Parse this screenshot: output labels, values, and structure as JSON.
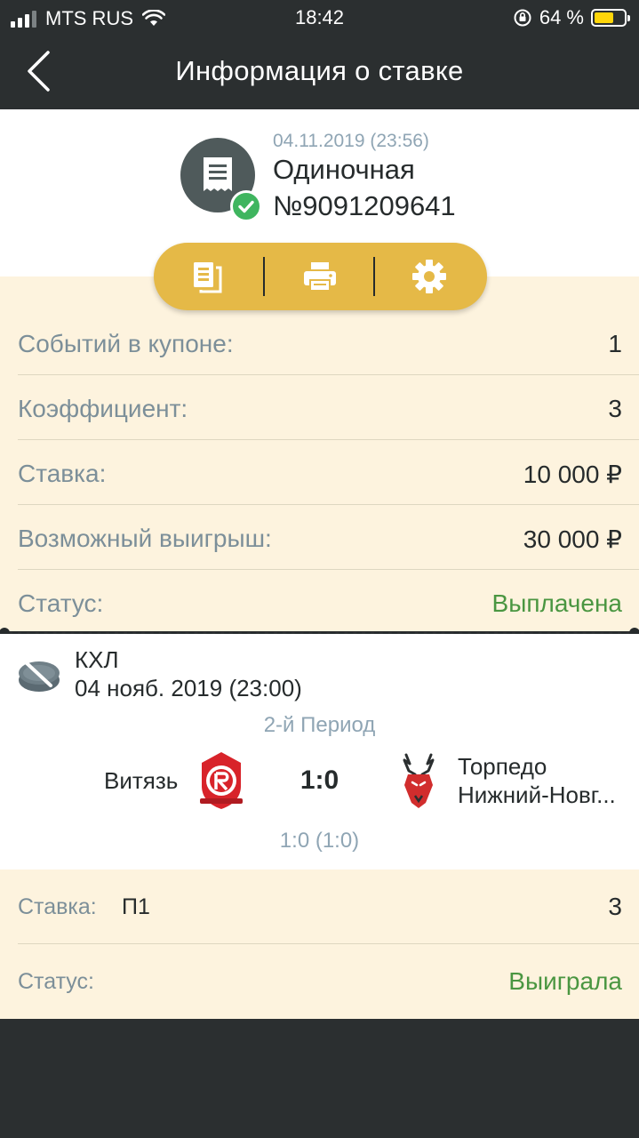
{
  "status_bar": {
    "carrier": "MTS RUS",
    "time": "18:42",
    "battery": "64 %",
    "battery_level": 0.64
  },
  "nav": {
    "title": "Информация о ставке",
    "back_icon": "chevron-left-icon"
  },
  "bet": {
    "date": "04.11.2019 (23:56)",
    "type": "Одиночная",
    "number": "№9091209641",
    "icon": "receipt-icon",
    "badge_icon": "check-icon"
  },
  "actions": [
    {
      "name": "copy",
      "icon": "documents-icon"
    },
    {
      "name": "print",
      "icon": "printer-icon"
    },
    {
      "name": "settings",
      "icon": "gear-icon"
    }
  ],
  "summary": [
    {
      "label": "Событий в купоне:",
      "value": "1"
    },
    {
      "label": "Коэффициент:",
      "value": "3"
    },
    {
      "label": "Ставка:",
      "value": "10 000 ₽"
    },
    {
      "label": "Возможный выигрыш:",
      "value": "30 000 ₽"
    },
    {
      "label": "Статус:",
      "value": "Выплачена"
    }
  ],
  "event": {
    "league": "КХЛ",
    "date": "04 нояб. 2019 (23:00)",
    "period": "2-й Период",
    "home_team": "Витязь",
    "score": "1:0",
    "away_team_line1": "Торпедо",
    "away_team_line2": "Нижний-Новг...",
    "period_score": "1:0 (1:0)"
  },
  "outcome": {
    "stake_label": "Ставка:",
    "pick": "П1",
    "odds": "3",
    "status_label": "Статус:",
    "status": "Выиграла"
  },
  "colors": {
    "dark": "#2b2f30",
    "cream": "#fdf3de",
    "accent": "#e5b947",
    "green": "#4a9641",
    "muted": "#7c8f99"
  }
}
